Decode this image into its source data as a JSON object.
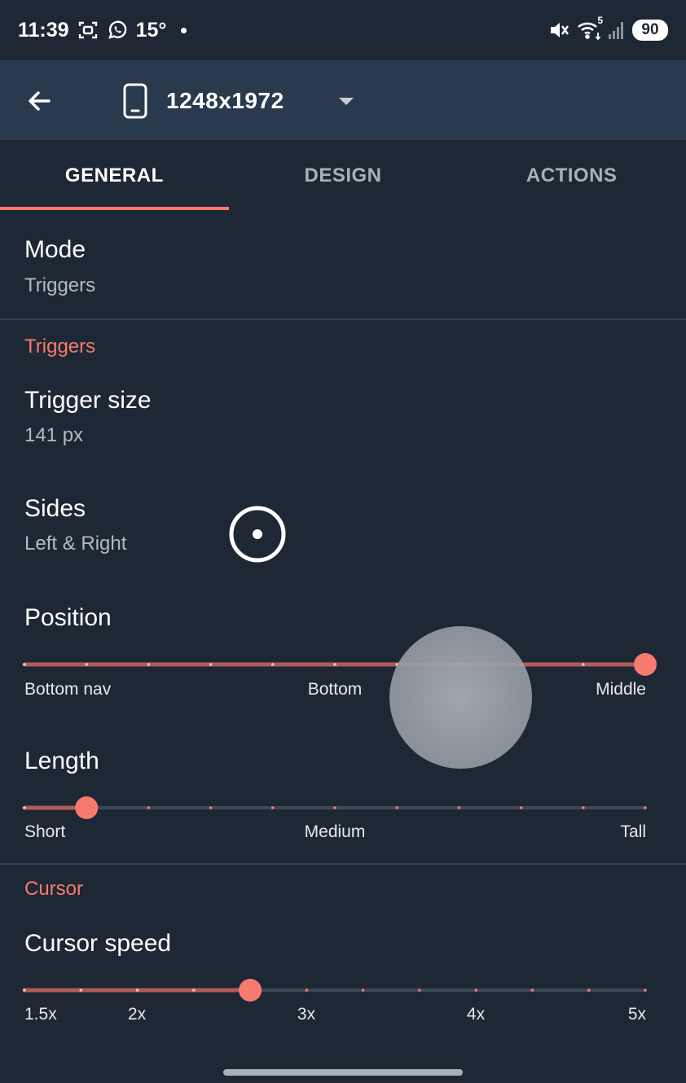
{
  "status_bar": {
    "time": "11:39",
    "temperature": "15°",
    "battery": "90",
    "wifi_badge": "5",
    "icons": [
      "screenshot-icon",
      "whatsapp-icon",
      "mute-icon",
      "wifi-icon",
      "signal-icon",
      "battery-icon"
    ]
  },
  "app_bar": {
    "device_label": "1248x1972",
    "icons": [
      "back-arrow-icon",
      "phone-icon",
      "dropdown-arrow-icon"
    ]
  },
  "tabs": [
    {
      "label": "GENERAL",
      "active": true
    },
    {
      "label": "DESIGN",
      "active": false
    },
    {
      "label": "ACTIONS",
      "active": false
    }
  ],
  "mode": {
    "title": "Mode",
    "summary": "Triggers"
  },
  "triggers_section": {
    "header": "Triggers"
  },
  "trigger_size": {
    "title": "Trigger size",
    "summary": "141 px"
  },
  "sides": {
    "title": "Sides",
    "summary": "Left & Right"
  },
  "position": {
    "title": "Position",
    "labels": [
      "Bottom nav",
      "Bottom",
      "Middle"
    ],
    "steps": 10,
    "value_step": 10
  },
  "length": {
    "title": "Length",
    "labels": [
      "Short",
      "Medium",
      "Tall"
    ],
    "steps": 10,
    "value_step": 1
  },
  "cursor_section": {
    "header": "Cursor"
  },
  "cursor_speed": {
    "title": "Cursor speed",
    "labels": [
      "1.5x",
      "2x",
      "3x",
      "4x",
      "5x"
    ],
    "steps": 11,
    "value_step": 4
  },
  "colors": {
    "accent": "#f77a6e",
    "background": "#1e2835",
    "app_bar": "#2a3a4e",
    "track_inactive": "#3d4958"
  }
}
